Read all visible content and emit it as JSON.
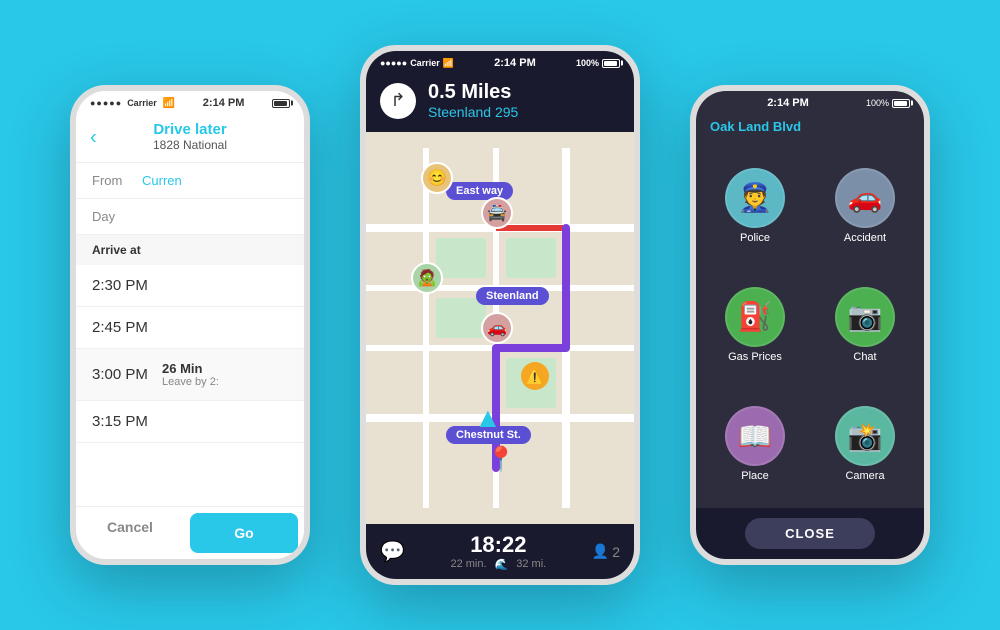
{
  "background_color": "#29C7E8",
  "phones": {
    "left": {
      "status_bar": {
        "carrier": "Carrier",
        "signal_dots": 5,
        "time": "2:14 PM",
        "wifi": "wifi"
      },
      "header": {
        "back_label": "‹",
        "title": "Drive later",
        "subtitle": "1828 National"
      },
      "form": {
        "from_label": "From",
        "from_value": "Curren",
        "day_label": "Day"
      },
      "section_header": "Arrive at",
      "times": [
        {
          "time": "2:30 PM",
          "info": "",
          "highlighted": false
        },
        {
          "time": "2:45 PM",
          "info": "",
          "highlighted": false
        },
        {
          "time": "3:00 PM",
          "info_title": "26 Min",
          "info_sub": "Leave by 2:",
          "highlighted": true
        },
        {
          "time": "3:15 PM",
          "info": "",
          "highlighted": false
        }
      ],
      "footer": {
        "cancel_label": "Cancel",
        "go_label": "Go"
      }
    },
    "center": {
      "status_bar": {
        "carrier": "Carrier",
        "time": "2:14 PM",
        "battery": "100%"
      },
      "nav": {
        "distance": "0.5 Miles",
        "street": "Steenland 295"
      },
      "map_labels": [
        "East way",
        "Steenland",
        "Chestnut St."
      ],
      "footer": {
        "time": "18:22",
        "duration": "22 min.",
        "distance": "32 mi.",
        "passengers": "2"
      }
    },
    "right": {
      "status_bar": {
        "time": "2:14 PM",
        "battery": "100%"
      },
      "top_bar": "Oak Land Blvd",
      "menu_items": [
        {
          "label": "Police",
          "icon": "👮",
          "color": "#5BB8C4"
        },
        {
          "label": "Accident",
          "icon": "🚗",
          "color": "#7B8FA8"
        },
        {
          "label": "Gas Prices",
          "icon": "⛽",
          "color": "#4CAF50"
        },
        {
          "label": "Chat",
          "icon": "📷",
          "color": "#4CAF50"
        },
        {
          "label": "Place",
          "icon": "📖",
          "color": "#9C6BAF"
        },
        {
          "label": "Camera",
          "icon": "📸",
          "color": "#5BB8A0"
        }
      ],
      "close_label": "CLOSE"
    }
  }
}
